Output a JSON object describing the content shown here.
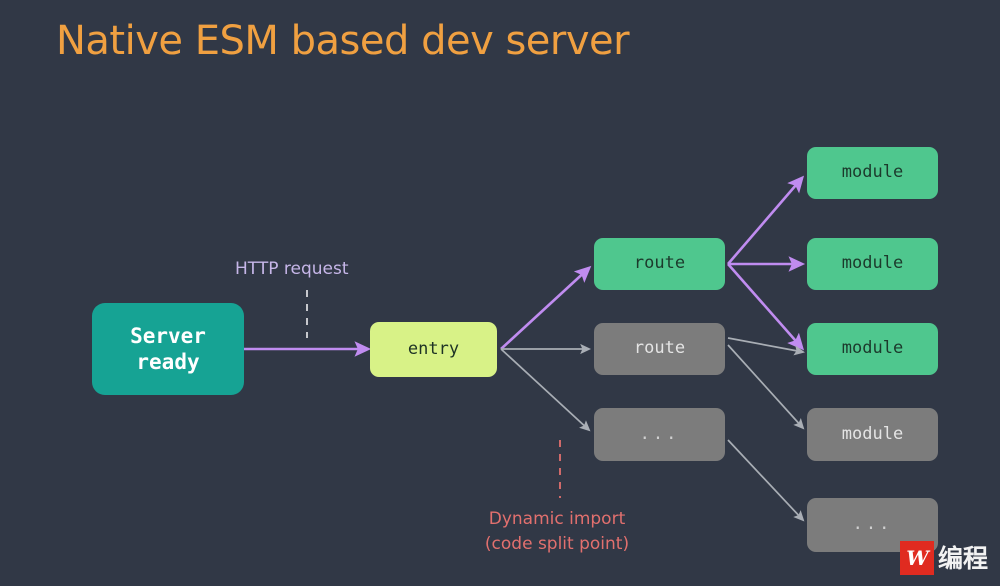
{
  "title": "Native ESM based dev server",
  "colors": {
    "background": "#313846",
    "title": "#f0a041",
    "server": "#16a394",
    "entry": "#d8f287",
    "active": "#4fc78e",
    "inactive": "#7c7c7c",
    "purple_edge": "#c08cf0",
    "gray_edge": "#a9aeb5",
    "http_label": "#c6b6e8",
    "dynamic_label": "#e2706e"
  },
  "nodes": {
    "server": {
      "line1": "Server",
      "line2": "ready"
    },
    "entry": {
      "label": "entry"
    },
    "route_active": {
      "label": "route"
    },
    "route_inactive": {
      "label": "route"
    },
    "route_dots": {
      "label": "..."
    },
    "module_1": {
      "label": "module"
    },
    "module_2": {
      "label": "module"
    },
    "module_3": {
      "label": "module"
    },
    "module_4": {
      "label": "module"
    },
    "module_dots": {
      "label": "..."
    }
  },
  "captions": {
    "http_request": "HTTP request",
    "dynamic_import_line1": "Dynamic import",
    "dynamic_import_line2": "(code split point)"
  },
  "watermark": {
    "mark": "W",
    "text": "编程"
  }
}
